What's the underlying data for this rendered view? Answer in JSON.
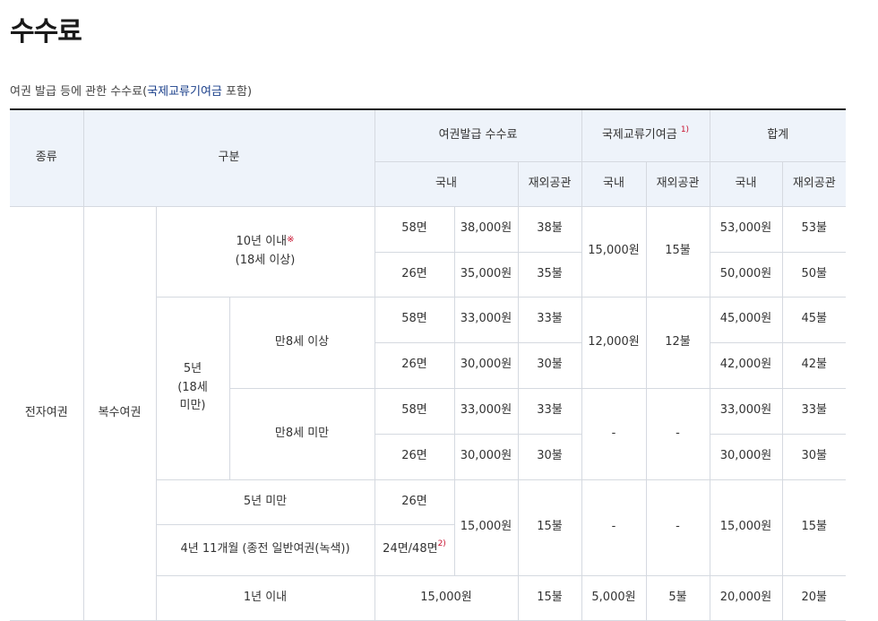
{
  "title": "수수료",
  "caption": {
    "prefix": "여권 발급 등에 관한 수수료(",
    "highlight": "국제교류기여금",
    "suffix": " 포함)"
  },
  "headers": {
    "type": "종류",
    "category": "구분",
    "issue_fee": "여권발급 수수료",
    "intl_fund": "국제교류기여금",
    "intl_fund_note": "1)",
    "total": "합계",
    "domestic": "국내",
    "overseas": "재외공관"
  },
  "rows": {
    "type": "전자여권",
    "subtype": "복수여권",
    "g1_label_line1": "10년 이내",
    "g1_mark": "※",
    "g1_label_line2": "(18세 이상)",
    "g1": [
      {
        "pages": "58면",
        "domestic": "38,000원",
        "overseas": "38불",
        "total_domestic": "53,000원",
        "total_overseas": "53불"
      },
      {
        "pages": "26면",
        "domestic": "35,000원",
        "overseas": "35불",
        "total_domestic": "50,000원",
        "total_overseas": "50불"
      }
    ],
    "g1_fund_domestic": "15,000원",
    "g1_fund_overseas": "15불",
    "g2_label_line1": "5년",
    "g2_label_line2": "(18세",
    "g2_label_line3": "미만)",
    "g2a_label": "만8세 이상",
    "g2a": [
      {
        "pages": "58면",
        "domestic": "33,000원",
        "overseas": "33불",
        "total_domestic": "45,000원",
        "total_overseas": "45불"
      },
      {
        "pages": "26면",
        "domestic": "30,000원",
        "overseas": "30불",
        "total_domestic": "42,000원",
        "total_overseas": "42불"
      }
    ],
    "g2a_fund_domestic": "12,000원",
    "g2a_fund_overseas": "12불",
    "g2b_label": "만8세 미만",
    "g2b": [
      {
        "pages": "58면",
        "domestic": "33,000원",
        "overseas": "33불",
        "total_domestic": "33,000원",
        "total_overseas": "33불"
      },
      {
        "pages": "26면",
        "domestic": "30,000원",
        "overseas": "30불",
        "total_domestic": "30,000원",
        "total_overseas": "30불"
      }
    ],
    "g2b_fund_domestic": "-",
    "g2b_fund_overseas": "-",
    "g3_label": "5년 미만",
    "g3_pages": "26면",
    "g4_label": "4년 11개월 (종전 일반여권(녹색))",
    "g4_pages": "24면/48면",
    "g4_note": "2)",
    "g34_domestic": "15,000원",
    "g34_overseas": "15불",
    "g34_fund_domestic": "-",
    "g34_fund_overseas": "-",
    "g34_total_domestic": "15,000원",
    "g34_total_overseas": "15불",
    "g5_label": "1년 이내",
    "g5_domestic": "15,000원",
    "g5_overseas": "15불",
    "g5_fund_domestic": "5,000원",
    "g5_fund_overseas": "5불",
    "g5_total_domestic": "20,000원",
    "g5_total_overseas": "20불"
  }
}
